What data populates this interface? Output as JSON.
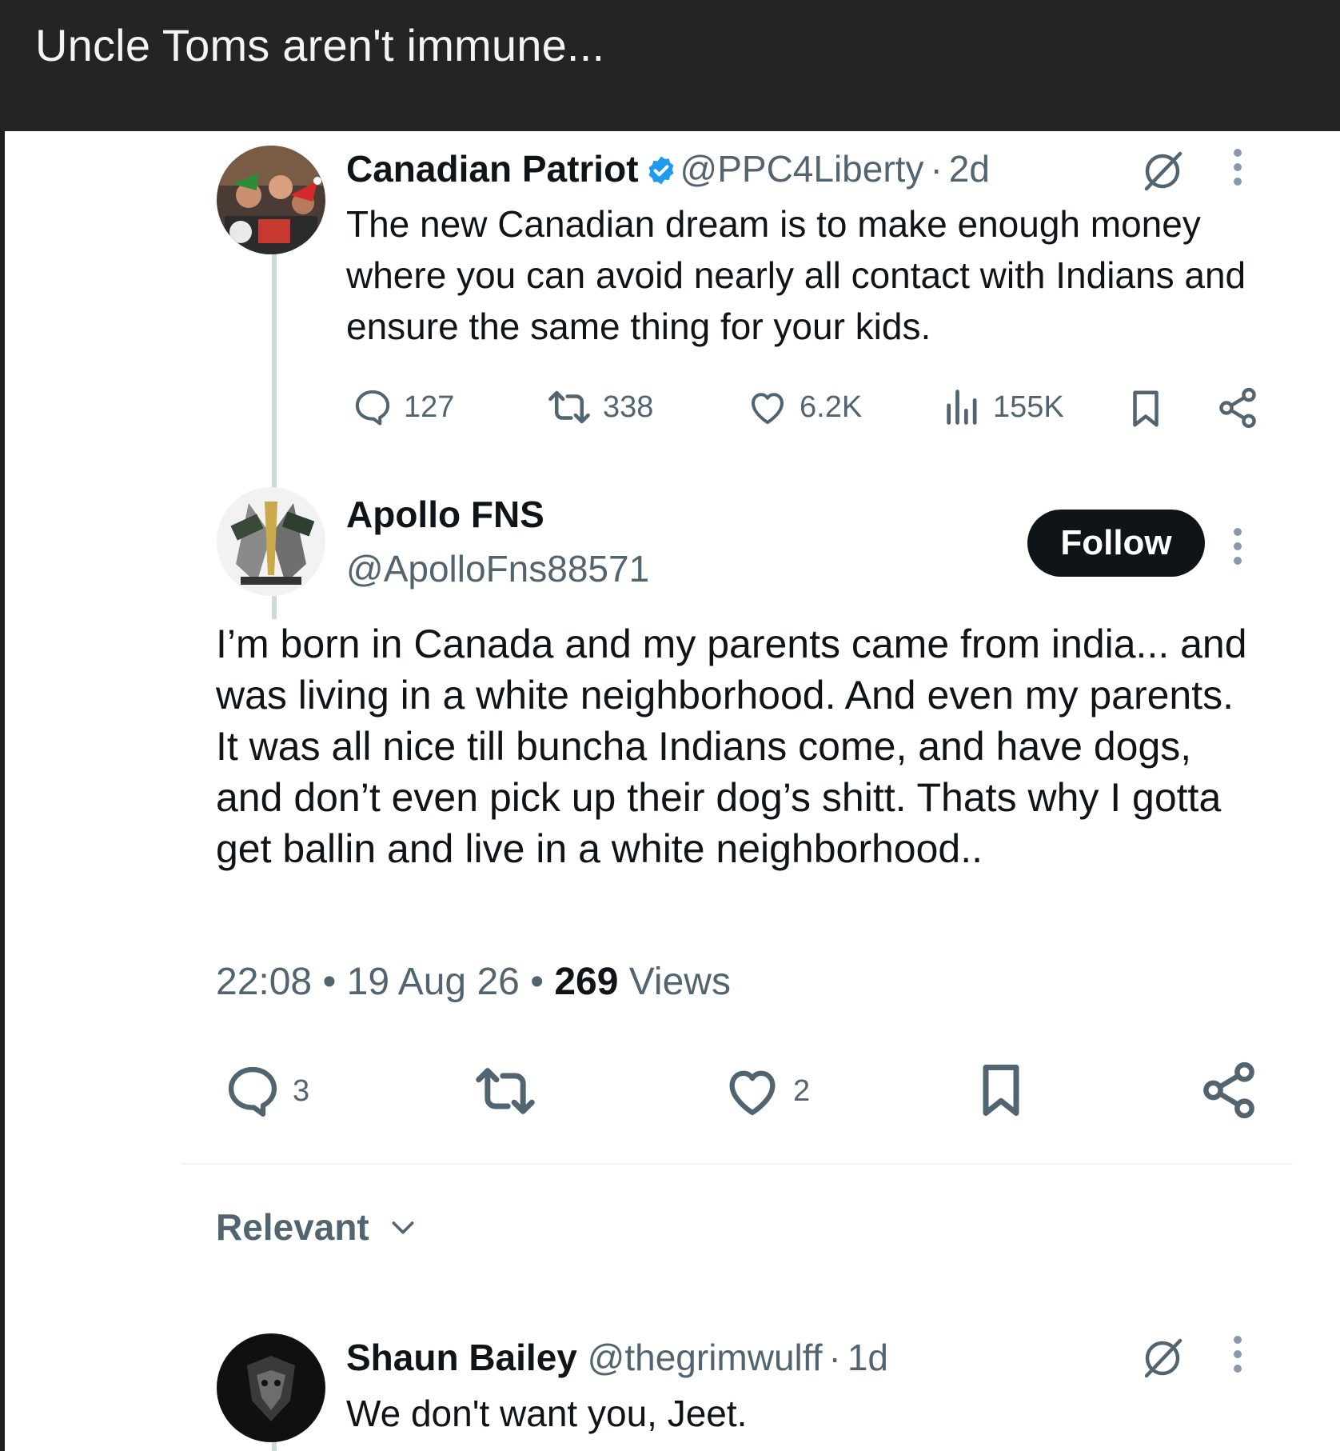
{
  "post_title": "Uncle Toms aren't immune...",
  "parent_tweet": {
    "display_name": "Canadian Patriot",
    "handle": "@PPC4Liberty",
    "separator": "·",
    "age": "2d",
    "text": "The new Canadian dream is to make enough money where you can avoid nearly all contact with Indians and ensure the same thing for your kids.",
    "replies": "127",
    "reposts": "338",
    "likes": "6.2K",
    "views": "155K",
    "icons": [
      "grok-icon",
      "more-icon",
      "reply-icon",
      "repost-icon",
      "like-icon",
      "views-icon",
      "bookmark-icon",
      "share-icon",
      "verified-badge-icon"
    ],
    "verified_color": "#1d9bf0"
  },
  "main_tweet": {
    "display_name": "Apollo FNS",
    "handle": "@ApolloFns88571",
    "follow_label": "Follow",
    "text": "I’m born in Canada and my parents came from india... and was living in a white neighborhood. And even my parents. It was all nice till buncha Indians come, and have dogs, and don’t even pick up their dog’s shitt. Thats why I gotta get ballin and live in a white neighborhood..",
    "time": "22:08",
    "date": "19 Aug 26",
    "bullet": "•",
    "views_count": "269",
    "views_label": "Views",
    "replies": "3",
    "likes": "2"
  },
  "sort": {
    "label": "Relevant"
  },
  "reply_tweet": {
    "display_name": "Shaun Bailey",
    "handle": "@thegrimwulff",
    "separator": "·",
    "age": "1d",
    "text": "We don't want you, Jeet."
  },
  "colors": {
    "top_bar": "#242424",
    "secondary_text": "#536471",
    "primary_text": "#0f1419",
    "follow_button": "#0f1419",
    "thread_line": "#cfd9de"
  }
}
